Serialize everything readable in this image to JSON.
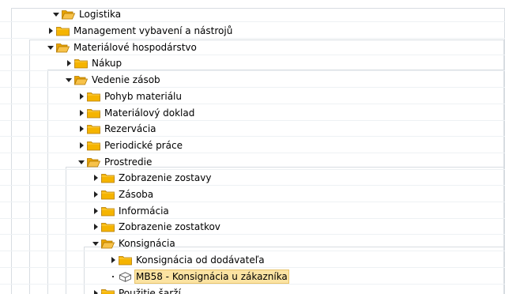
{
  "tree": {
    "nodes": [
      {
        "id": "logistika",
        "label": "Logistika",
        "state": "expanded",
        "icon": "folder-open-icon",
        "depth": 0
      },
      {
        "id": "management",
        "label": "Management vybavení a nástrojů",
        "state": "collapsed",
        "icon": "folder-icon",
        "depth": 1
      },
      {
        "id": "materialove",
        "label": "Materiálové hospodárstvo",
        "state": "expanded",
        "icon": "folder-open-icon",
        "depth": 1
      },
      {
        "id": "nakup",
        "label": "Nákup",
        "state": "collapsed",
        "icon": "folder-icon",
        "depth": 2
      },
      {
        "id": "vedenie",
        "label": "Vedenie zásob",
        "state": "expanded",
        "icon": "folder-open-icon",
        "depth": 2
      },
      {
        "id": "pohyb",
        "label": "Pohyb materiálu",
        "state": "collapsed",
        "icon": "folder-icon",
        "depth": 3
      },
      {
        "id": "doklad",
        "label": "Materiálový doklad",
        "state": "collapsed",
        "icon": "folder-icon",
        "depth": 3
      },
      {
        "id": "rezervacia",
        "label": "Rezervácia",
        "state": "collapsed",
        "icon": "folder-icon",
        "depth": 3
      },
      {
        "id": "periodicke",
        "label": "Periodické práce",
        "state": "collapsed",
        "icon": "folder-icon",
        "depth": 3
      },
      {
        "id": "prostredie",
        "label": "Prostredie",
        "state": "expanded",
        "icon": "folder-open-icon",
        "depth": 3
      },
      {
        "id": "zostavy",
        "label": "Zobrazenie zostavy",
        "state": "collapsed",
        "icon": "folder-icon",
        "depth": 4
      },
      {
        "id": "zasoba",
        "label": "Zásoba",
        "state": "collapsed",
        "icon": "folder-icon",
        "depth": 4
      },
      {
        "id": "informacia",
        "label": "Informácia",
        "state": "collapsed",
        "icon": "folder-icon",
        "depth": 4
      },
      {
        "id": "zostatkov",
        "label": "Zobrazenie zostatkov",
        "state": "collapsed",
        "icon": "folder-icon",
        "depth": 4
      },
      {
        "id": "konsignacia",
        "label": "Konsignácia",
        "state": "expanded",
        "icon": "folder-open-icon",
        "depth": 4
      },
      {
        "id": "od-dodavatela",
        "label": "Konsignácia od dodávateľa",
        "state": "collapsed",
        "icon": "folder-icon",
        "depth": 5
      },
      {
        "id": "mb58",
        "label": "MB58 - Konsignácia u zákazníka",
        "state": "leaf",
        "icon": "transaction-cube-icon",
        "depth": 5,
        "selected": true
      },
      {
        "id": "pouzitie",
        "label": "Použitie šarží",
        "state": "collapsed",
        "icon": "folder-icon",
        "depth": 4
      }
    ]
  },
  "colors": {
    "folder_fill": "#f5b400",
    "folder_open_fill": "#f7c24a",
    "selection_bg": "#fbe3a2",
    "guide_line": "#d8dde2"
  }
}
